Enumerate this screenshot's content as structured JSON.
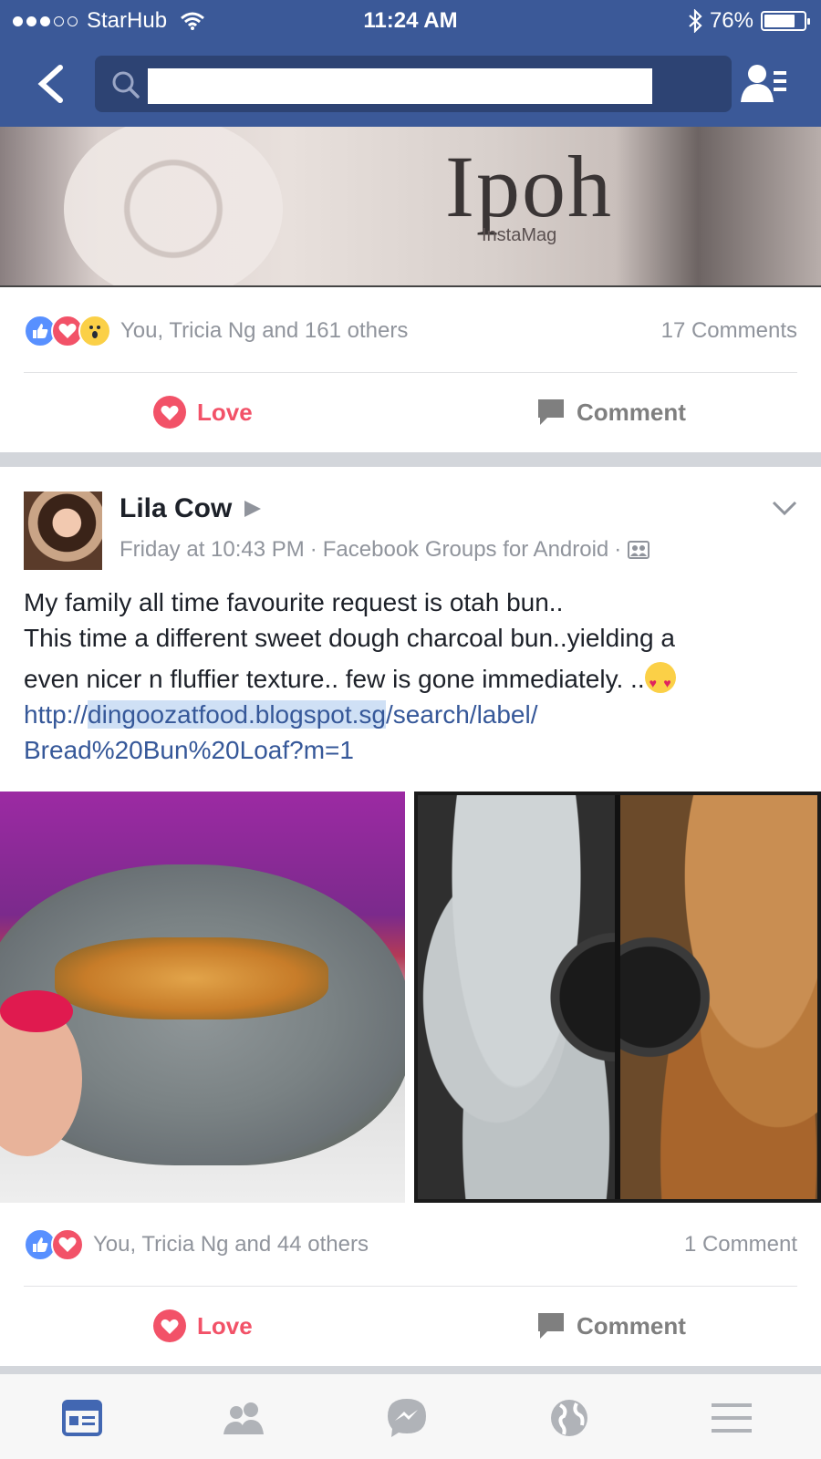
{
  "status_bar": {
    "carrier": "StarHub",
    "time": "11:24 AM",
    "battery": "76%",
    "battery_level": 0.76
  },
  "nav": {
    "search_value": ""
  },
  "banner": {
    "text": "Ipoh",
    "sub": "InstaMag"
  },
  "post1": {
    "reactions_text": "You, Tricia Ng and 161 others",
    "comments_count": "17 Comments",
    "love_label": "Love",
    "comment_label": "Comment"
  },
  "post2": {
    "author": "Lila Cow",
    "time": "Friday at 10:43 PM",
    "dot": "·",
    "source": "Facebook Groups for Android",
    "text_line1": "My family all time favourite request is otah bun..",
    "text_line2": "This time a different sweet dough charcoal bun..yielding a",
    "text_line3": "even  nicer n fluffier texture.. few is gone immediately. ..",
    "link_prefix": "http://",
    "link_highlight": "dingoozatfood.blogspot.sg",
    "link_suffix": "/search/label/",
    "link_line2": "Bread%20Bun%20Loaf?m=1",
    "reactions_text": "You, Tricia Ng and 44 others",
    "comments_count": "1 Comment",
    "love_label": "Love",
    "comment_label": "Comment"
  },
  "colors": {
    "brand": "#3b5998",
    "love": "#f25268",
    "like": "#5890ff",
    "link": "#365899",
    "active_tab": "#4267b2",
    "inactive_tab": "#b0b3b8"
  },
  "tabs": [
    "news-feed",
    "friends",
    "messenger",
    "notifications",
    "menu"
  ],
  "active_tab": "news-feed"
}
